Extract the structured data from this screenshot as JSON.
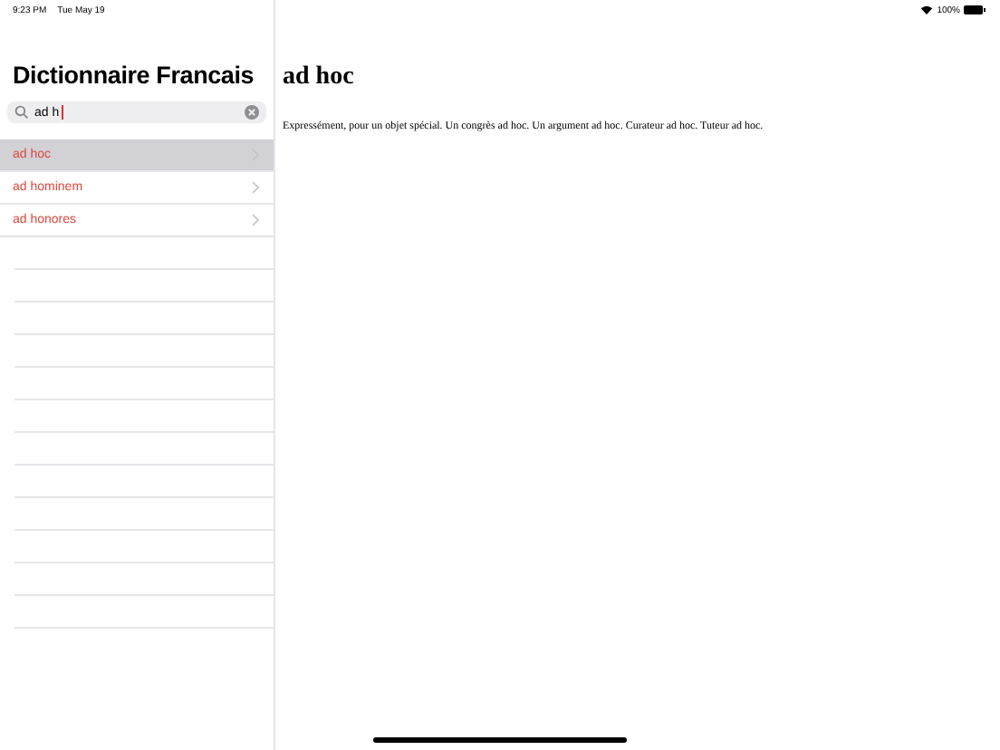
{
  "status_bar": {
    "time": "9:23 PM",
    "date": "Tue May 19",
    "battery": "100%"
  },
  "sidebar": {
    "title": "Dictionnaire Francais",
    "search": {
      "value": "ad h"
    },
    "items": [
      {
        "label": "ad hoc",
        "selected": true
      },
      {
        "label": "ad hominem",
        "selected": false
      },
      {
        "label": "ad honores",
        "selected": false
      }
    ]
  },
  "detail": {
    "title": "ad hoc",
    "definition": "Expressément, pour un objet spécial. Un congrès ad hoc. Un argument ad hoc. Curateur ad hoc. Tuteur ad hoc."
  }
}
